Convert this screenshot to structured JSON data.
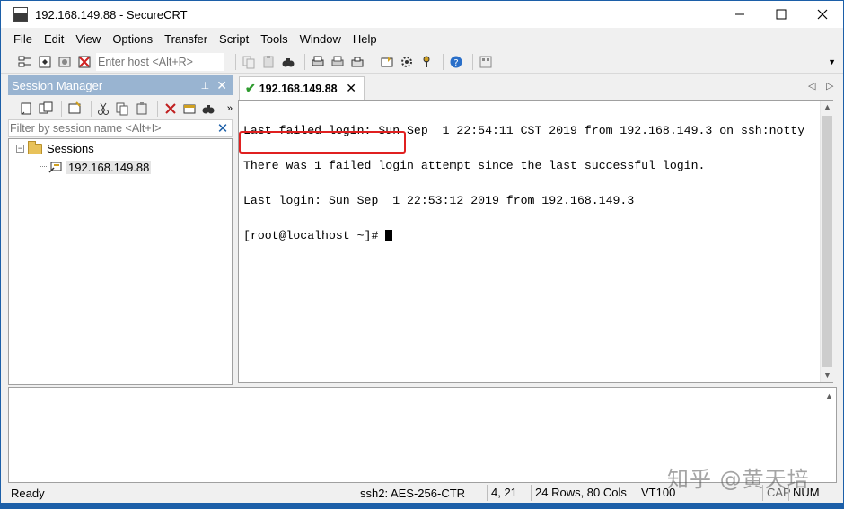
{
  "window": {
    "title": "192.168.149.88 - SecureCRT"
  },
  "menu": [
    "File",
    "Edit",
    "View",
    "Options",
    "Transfer",
    "Script",
    "Tools",
    "Window",
    "Help"
  ],
  "toolbar": {
    "host_placeholder": "Enter host <Alt+R>"
  },
  "session_manager": {
    "title": "Session Manager",
    "filter_placeholder": "Filter by session name <Alt+I>",
    "folder": "Sessions",
    "session": "192.168.149.88"
  },
  "tab": {
    "label": "192.168.149.88"
  },
  "terminal": {
    "lines": [
      "Last failed login: Sun Sep  1 22:54:11 CST 2019 from 192.168.149.3 on ssh:notty",
      "There was 1 failed login attempt since the last successful login.",
      "Last login: Sun Sep  1 22:53:12 2019 from 192.168.149.3"
    ],
    "prompt": "[root@localhost ~]# "
  },
  "status": {
    "ready": "Ready",
    "cipher": "ssh2: AES-256-CTR",
    "position": "4,  21",
    "size": "24 Rows, 80 Cols",
    "emulation": "VT100",
    "cap": "CAP",
    "num": "NUM"
  },
  "watermark": "知乎 @黄天培",
  "colors": {
    "accent": "#1c5fa8",
    "highlight": "#e02020",
    "panel_header": "#99b4d1"
  }
}
